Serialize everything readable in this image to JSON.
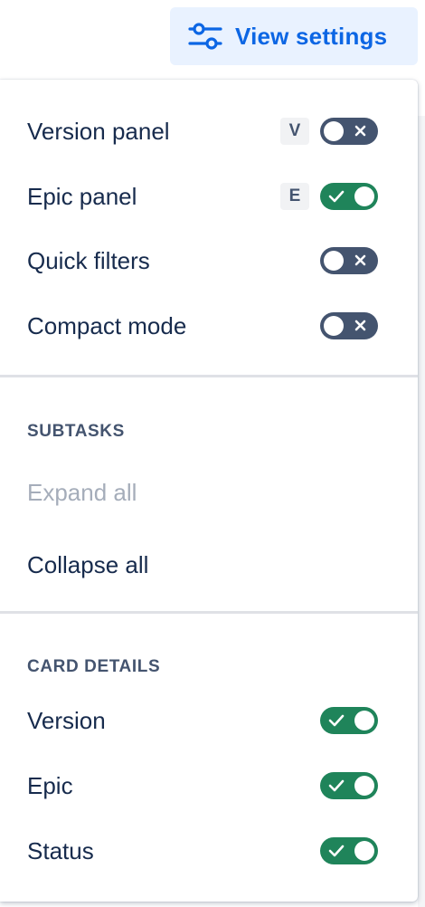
{
  "header": {
    "view_settings_label": "View settings",
    "view_settings_icon": "sliders-icon"
  },
  "panels": {
    "items": [
      {
        "label": "Version panel",
        "shortcut": "V",
        "enabled": false
      },
      {
        "label": "Epic panel",
        "shortcut": "E",
        "enabled": true
      },
      {
        "label": "Quick filters",
        "shortcut": "",
        "enabled": false
      },
      {
        "label": "Compact mode",
        "shortcut": "",
        "enabled": false
      }
    ]
  },
  "subtasks": {
    "heading": "SUBTASKS",
    "expand_all": "Expand all",
    "expand_all_disabled": true,
    "collapse_all": "Collapse all"
  },
  "card_details": {
    "heading": "CARD DETAILS",
    "items": [
      {
        "label": "Version",
        "enabled": true
      },
      {
        "label": "Epic",
        "enabled": true
      },
      {
        "label": "Status",
        "enabled": true
      }
    ]
  },
  "colors": {
    "accent": "#0c66e4",
    "button_bg": "#e9f2ff",
    "toggle_on": "#1f845a",
    "toggle_off": "#44546f",
    "text": "#172b4d",
    "disabled_text": "#a5adba"
  }
}
